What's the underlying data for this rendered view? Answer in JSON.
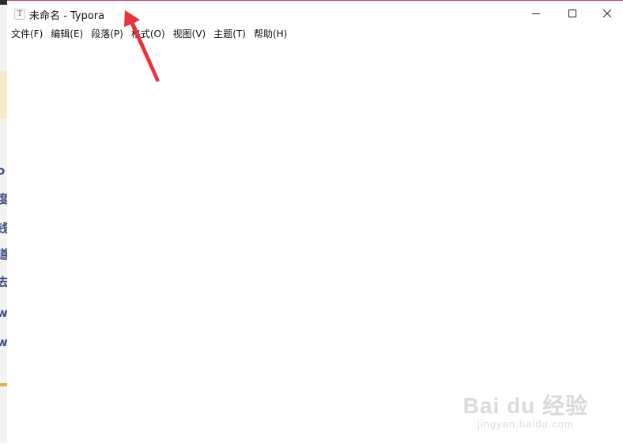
{
  "window": {
    "icon_letter": "T",
    "title": "未命名 - Typora"
  },
  "menu": {
    "items": [
      {
        "label": "文件(F)"
      },
      {
        "label": "编辑(E)"
      },
      {
        "label": "段落(P)"
      },
      {
        "label": "格式(O)"
      },
      {
        "label": "视图(V)"
      },
      {
        "label": "主题(T)"
      },
      {
        "label": "帮助(H)"
      }
    ]
  },
  "background_window": {
    "partial_glyphs": [
      "o",
      "度",
      "钱",
      "道",
      "去",
      "w",
      "w"
    ]
  },
  "watermark": {
    "brand": "Bai du 经验",
    "site": "jingyan.baidu.com"
  },
  "colors": {
    "window_border": "#d23b6a",
    "annotation_arrow": "#e8333a"
  }
}
